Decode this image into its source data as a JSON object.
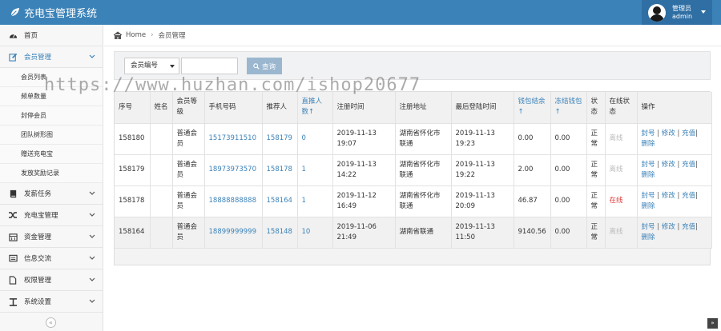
{
  "app": {
    "title": "充电宝管理系统"
  },
  "user": {
    "role": "管理员",
    "name": "admin"
  },
  "sidebar": {
    "items": [
      {
        "label": "首页",
        "icon": "dashboard-icon"
      },
      {
        "label": "会员管理",
        "icon": "edit-icon"
      },
      {
        "label": "发薪任务",
        "icon": "book-icon"
      },
      {
        "label": "充电宝管理",
        "icon": "shuffle-icon"
      },
      {
        "label": "资金管理",
        "icon": "calendar-icon"
      },
      {
        "label": "信息交流",
        "icon": "list-icon"
      },
      {
        "label": "权限管理",
        "icon": "file-icon"
      },
      {
        "label": "系统设置",
        "icon": "text-icon"
      }
    ],
    "sub_items": [
      "会员列表",
      "频单数量",
      "封停会员",
      "团队树形图",
      "赠送充电宝",
      "发放奖励记录"
    ]
  },
  "breadcrumb": {
    "home": "Home",
    "current": "会员管理"
  },
  "search": {
    "select_value": "会员编号",
    "input_value": "",
    "button_label": "查询"
  },
  "table": {
    "headers": [
      "序号",
      "姓名",
      "会员等级",
      "手机号码",
      "推荐人",
      "直推人数↑",
      "注册时间",
      "注册地址",
      "最后登陆时间",
      "钱包结余↑",
      "冻结钱包↑",
      "状态",
      "在线状态",
      "操作"
    ],
    "rows": [
      {
        "id": "158180",
        "name": "",
        "level": "普通会员",
        "phone": "15173911510",
        "referrer": "158179",
        "direct": "0",
        "reg_time": "2019-11-13 19:07",
        "reg_addr": "湖南省怀化市联通",
        "last_login": "2019-11-13 19:23",
        "wallet": "0.00",
        "frozen": "0.00",
        "status": "正常",
        "online": "离线"
      },
      {
        "id": "158179",
        "name": "",
        "level": "普通会员",
        "phone": "18973973570",
        "referrer": "158178",
        "direct": "1",
        "reg_time": "2019-11-13 14:22",
        "reg_addr": "湖南省怀化市联通",
        "last_login": "2019-11-13 19:22",
        "wallet": "2.00",
        "frozen": "0.00",
        "status": "正常",
        "online": "离线"
      },
      {
        "id": "158178",
        "name": "",
        "level": "普通会员",
        "phone": "18888888888",
        "referrer": "158164",
        "direct": "1",
        "reg_time": "2019-11-12 16:49",
        "reg_addr": "湖南省怀化市联通",
        "last_login": "2019-11-13 20:09",
        "wallet": "46.87",
        "frozen": "0.00",
        "status": "正常",
        "online": "在线"
      },
      {
        "id": "158164",
        "name": "",
        "level": "普通会员",
        "phone": "18899999999",
        "referrer": "158148",
        "direct": "10",
        "reg_time": "2019-11-06 21:49",
        "reg_addr": "湖南省联通",
        "last_login": "2019-11-13 11:50",
        "wallet": "9140.56",
        "frozen": "0.00",
        "status": "正常",
        "online": "离线"
      }
    ],
    "ops": {
      "ban": "封号",
      "edit": "修改",
      "recharge": "充值",
      "delete": "删除"
    }
  },
  "watermark": "https://www.huzhan.com/ishop20677",
  "colors": {
    "header": "#3b82b8",
    "link": "#3b82b8",
    "online": "#e23b3b"
  }
}
